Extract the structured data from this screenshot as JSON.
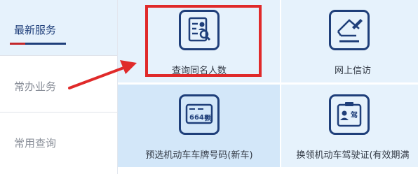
{
  "sidebar": {
    "items": [
      {
        "label": "最新服务",
        "active": true
      },
      {
        "label": "常办业务",
        "active": false
      },
      {
        "label": "常用查询",
        "active": false
      }
    ]
  },
  "tiles": [
    {
      "label": "查询同名人数",
      "icon": "id-search-icon"
    },
    {
      "label": "网上信访",
      "icon": "envelope-pen-icon"
    },
    {
      "label": "预选机动车车牌号码(新车)",
      "icon": "license-plate-icon"
    },
    {
      "label": "换领机动车驾驶证(有效期满",
      "icon": "driver-license-icon"
    }
  ],
  "plate_text": "6648",
  "plate_badge": "预",
  "license_badge": "驾",
  "colors": {
    "accent": "#1f3f7a",
    "highlight": "#e02a2a",
    "active_bar": "#c3272b",
    "tile_bg": "#e6f2fc"
  }
}
